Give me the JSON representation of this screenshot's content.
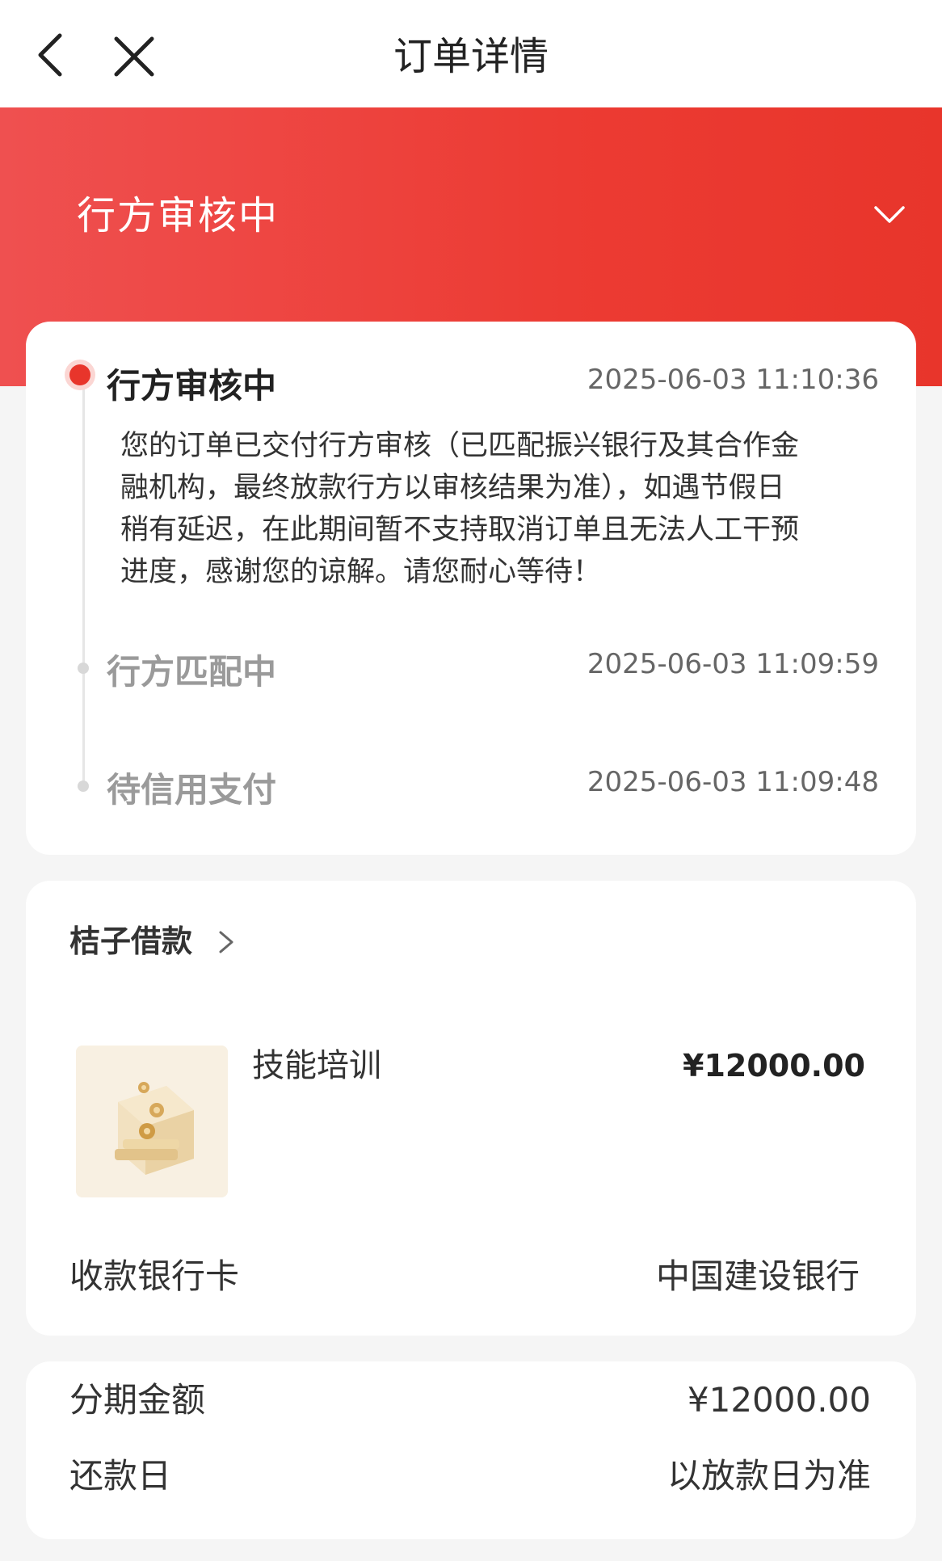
{
  "nav": {
    "title": "订单详情",
    "back_icon": "chevron-left-icon",
    "close_icon": "close-icon"
  },
  "banner": {
    "status": "行方审核中",
    "chevron_icon": "chevron-down-icon"
  },
  "timeline": {
    "steps": [
      {
        "title": "行方审核中",
        "time": "2025-06-03 11:10:36",
        "active": true,
        "desc_lines": [
          "您的订单已交付行方审核（已匹配振兴银行及其合作金",
          "融机构，最终放款行方以审核结果为准），如遇节假日",
          "稍有延迟，在此期间暂不支持取消订单且无法人工干预",
          "进度，感谢您的谅解。请您耐心等待！"
        ]
      },
      {
        "title": "行方匹配中",
        "time": "2025-06-03 11:09:59",
        "active": false
      },
      {
        "title": "待信用支付",
        "time": "2025-06-03 11:09:48",
        "active": false
      }
    ]
  },
  "product": {
    "merchant": "桔子借款",
    "name": "技能培训",
    "price": "¥12000.00",
    "bank_label": "收款银行卡",
    "bank_value": "中国建设银行"
  },
  "installment": {
    "amount_label": "分期金额",
    "amount_value": "¥12000.00",
    "repay_label": "还款日",
    "repay_value": "以放款日为准"
  },
  "colors": {
    "accent": "#e8352b",
    "banner_start": "#ef5050",
    "banner_end": "#e8352b"
  }
}
